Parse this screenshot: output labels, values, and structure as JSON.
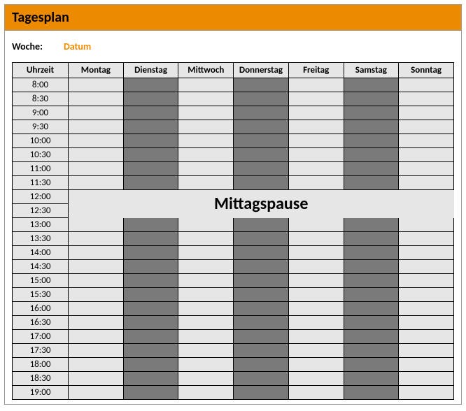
{
  "title": "Tagesplan",
  "week_label": "Woche:",
  "week_value": "Datum",
  "columns": [
    "Uhrzeit",
    "Montag",
    "Dienstag",
    "Mittwoch",
    "Donnerstag",
    "Freitag",
    "Samstag",
    "Sonntag"
  ],
  "times": [
    "8:00",
    "8:30",
    "9:00",
    "9:30",
    "10:00",
    "10:30",
    "11:00",
    "11:30",
    "12:00",
    "12:30",
    "13:00",
    "13:30",
    "14:00",
    "14:30",
    "15:00",
    "15:30",
    "16:00",
    "16:30",
    "17:00",
    "17:30",
    "18:00",
    "18:30",
    "19:00"
  ],
  "shading": [
    "light",
    "dark",
    "light",
    "dark",
    "light",
    "dark",
    "light"
  ],
  "lunch": {
    "label": "Mittagspause",
    "start_index": 8,
    "end_index": 9
  }
}
